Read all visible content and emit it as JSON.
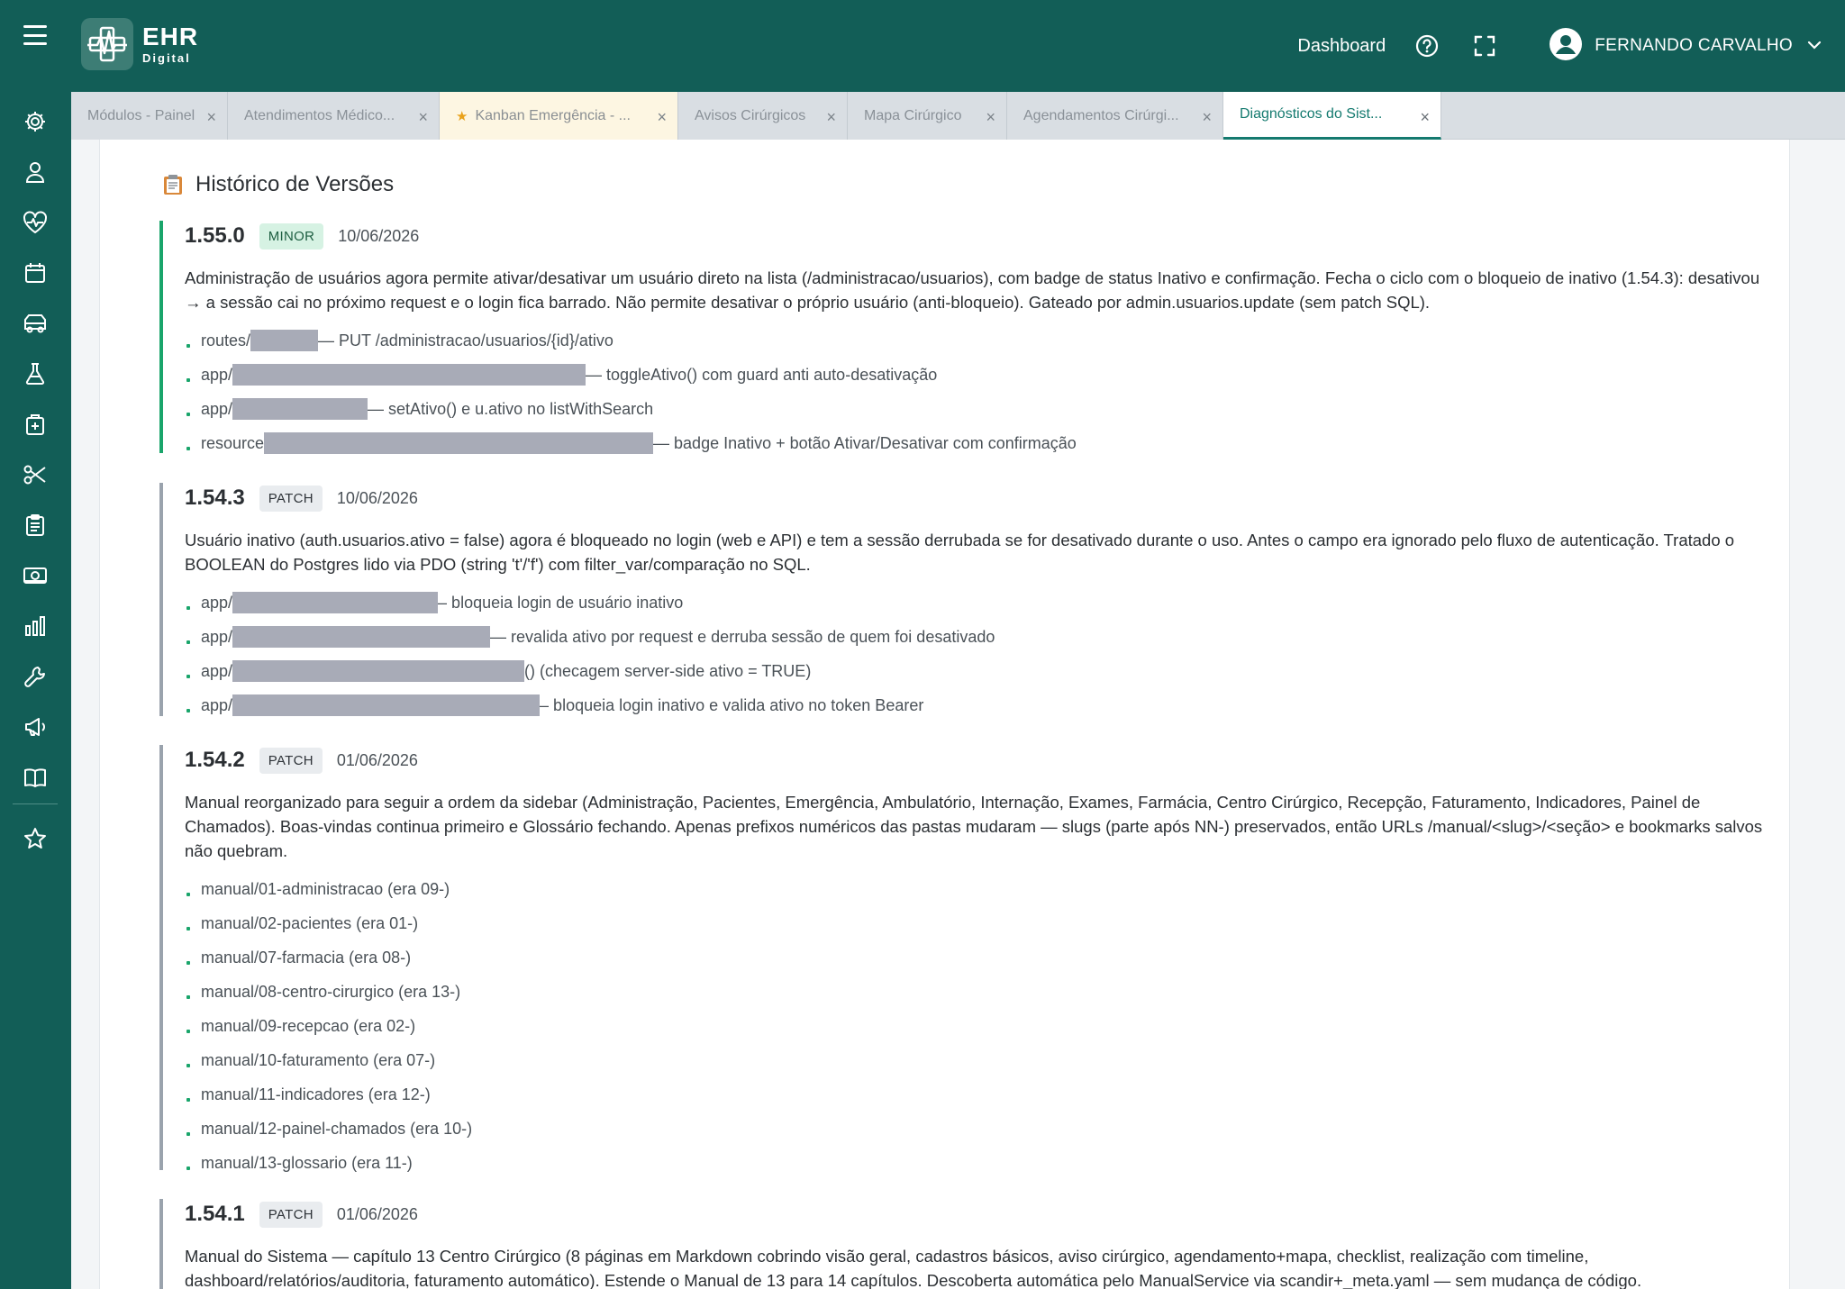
{
  "topbar": {
    "logo_title": "EHR",
    "logo_sub": "Digital",
    "dashboard_label": "Dashboard",
    "user_name": "FERNANDO CARVALHO"
  },
  "tabs": [
    {
      "label": "Módulos - Painel"
    },
    {
      "label": "Atendimentos Médico..."
    },
    {
      "label": "Kanban Emergência - ..."
    },
    {
      "label": "Avisos Cirúrgicos"
    },
    {
      "label": "Mapa Cirúrgico"
    },
    {
      "label": "Agendamentos Cirúrgi..."
    },
    {
      "label": "Diagnósticos do Sist..."
    }
  ],
  "tab_close_glyph": "×",
  "section_title": "Histórico de Versões",
  "versions": [
    {
      "number": "1.55.0",
      "type": "MINOR",
      "date": "10/06/2026",
      "description": "Administração de usuários agora permite ativar/desativar um usuário direto na lista (/administracao/usuarios), com badge de status Inativo e confirmação. Fecha o ciclo com o bloqueio de inativo (1.54.3): desativou → a sessão cai no próximo request e o login fica barrado. Não permite desativar o próprio usuário (anti-bloqueio). Gateado por admin.usuarios.update (sem patch SQL).",
      "items": [
        {
          "prefix": "routes/",
          "suffix": " — PUT /administracao/usuarios/{id}/ativo"
        },
        {
          "prefix": "app/",
          "suffix": " — toggleAtivo() com guard anti auto-desativação"
        },
        {
          "prefix": "app/",
          "suffix": " — setAtivo() e u.ativo no listWithSearch"
        },
        {
          "prefix": "resource",
          "suffix": " — badge Inativo + botão Ativar/Desativar com confirmação"
        }
      ]
    },
    {
      "number": "1.54.3",
      "type": "PATCH",
      "date": "10/06/2026",
      "description": "Usuário inativo (auth.usuarios.ativo = false) agora é bloqueado no login (web e API) e tem a sessão derrubada se for desativado durante o uso. Antes o campo era ignorado pelo fluxo de autenticação. Tratado o BOOLEAN do Postgres lido via PDO (string 't'/'f') com filter_var/comparação no SQL.",
      "items": [
        {
          "prefix": "app/",
          "suffix": "– bloqueia login de usuário inativo"
        },
        {
          "prefix": "app/",
          "suffix": "— revalida ativo por request e derruba sessão de quem foi desativado"
        },
        {
          "prefix": "app/",
          "suffix": "() (checagem server-side ativo = TRUE)"
        },
        {
          "prefix": "app/",
          "suffix": "– bloqueia login inativo e valida ativo no token Bearer"
        }
      ]
    },
    {
      "number": "1.54.2",
      "type": "PATCH",
      "date": "01/06/2026",
      "description": "Manual reorganizado para seguir a ordem da sidebar (Administração, Pacientes, Emergência, Ambulatório, Internação, Exames, Farmácia, Centro Cirúrgico, Recepção, Faturamento, Indicadores, Painel de Chamados). Boas-vindas continua primeiro e Glossário fechando. Apenas prefixos numéricos das pastas mudaram — slugs (parte após NN-) preservados, então URLs /manual/<slug>/<seção> e bookmarks salvos não quebram.",
      "items": [
        {
          "prefix": "manual/01-administracao (era 09-)",
          "suffix": ""
        },
        {
          "prefix": "manual/02-pacientes (era 01-)",
          "suffix": ""
        },
        {
          "prefix": "manual/07-farmacia (era 08-)",
          "suffix": ""
        },
        {
          "prefix": "manual/08-centro-cirurgico (era 13-)",
          "suffix": ""
        },
        {
          "prefix": "manual/09-recepcao (era 02-)",
          "suffix": ""
        },
        {
          "prefix": "manual/10-faturamento (era 07-)",
          "suffix": ""
        },
        {
          "prefix": "manual/11-indicadores (era 12-)",
          "suffix": ""
        },
        {
          "prefix": "manual/12-painel-chamados (era 10-)",
          "suffix": ""
        },
        {
          "prefix": "manual/13-glossario (era 11-)",
          "suffix": ""
        }
      ]
    },
    {
      "number": "1.54.1",
      "type": "PATCH",
      "date": "01/06/2026",
      "description": "Manual do Sistema — capítulo 13 Centro Cirúrgico (8 páginas em Markdown cobrindo visão geral, cadastros básicos, aviso cirúrgico, agendamento+mapa, checklist, realização com timeline, dashboard/relatórios/auditoria, faturamento automático). Estende o Manual de 13 para 14 capítulos. Descoberta automática pelo ManualService via scandir+_meta.yaml — sem mudança de código.",
      "items": []
    }
  ],
  "colors": {
    "brand": "#125e57",
    "accent_green": "#1aa56b",
    "active_tab": "#147a6f",
    "pinned_star": "#e9a21b"
  },
  "sidebar_icons": [
    "gear-icon",
    "user-icon",
    "heart-pulse-icon",
    "calendar-icon",
    "ambulance-icon",
    "flask-icon",
    "medical-kit-icon",
    "scissors-icon",
    "clipboard-icon",
    "cash-icon",
    "bar-chart-icon",
    "wrench-icon",
    "megaphone-icon",
    "book-icon",
    "star-icon"
  ]
}
